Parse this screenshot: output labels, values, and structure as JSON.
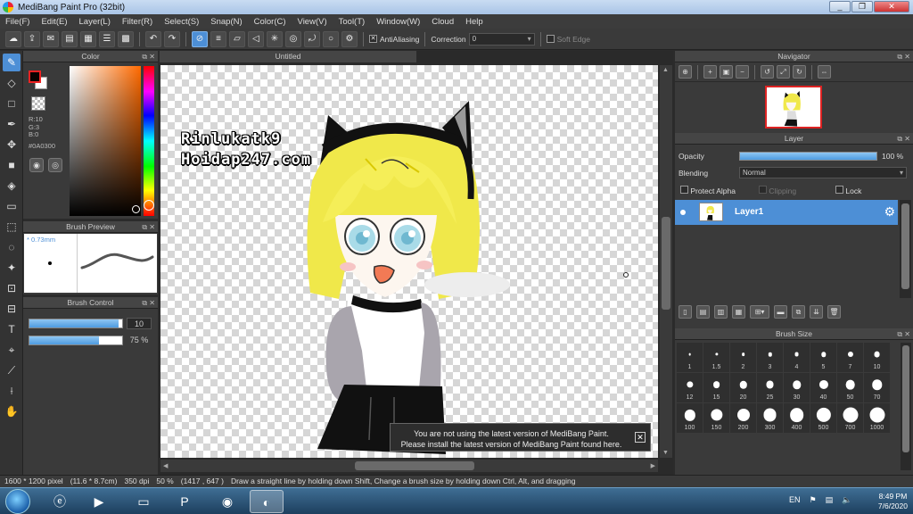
{
  "window": {
    "title": "MediBang Paint Pro (32bit)",
    "min": "_",
    "max": "❐",
    "close": "✕"
  },
  "menu": [
    "File(F)",
    "Edit(E)",
    "Layer(L)",
    "Filter(R)",
    "Select(S)",
    "Snap(N)",
    "Color(C)",
    "View(V)",
    "Tool(T)",
    "Window(W)",
    "Cloud",
    "Help"
  ],
  "toolbar": {
    "antialiasing_label": "AntiAliasing",
    "correction_label": "Correction",
    "correction_value": "0",
    "soft_edge_label": "Soft Edge"
  },
  "color_panel": {
    "title": "Color",
    "r": "R:10",
    "g": "G:3",
    "b": "B:0",
    "hex": "#0A0300",
    "fg_color": "#0a0300"
  },
  "brush_preview": {
    "title": "Brush Preview",
    "size_label": "* 0.73mm"
  },
  "brush_control": {
    "title": "Brush Control",
    "size_value": "10",
    "size_fill": 0.96,
    "opacity_value": "75 %",
    "opacity_fill": 0.75
  },
  "document": {
    "tab_title": "Untitled"
  },
  "watermark": {
    "line1": "Rinlukatk9",
    "line2": "Hoidap247.com"
  },
  "notice": {
    "line1": "You are not using the latest version of MediBang Paint.",
    "line2": "Please install the latest version of MediBang Paint found here.",
    "close": "✕"
  },
  "navigator": {
    "title": "Navigator"
  },
  "layer_panel": {
    "title": "Layer",
    "opacity_label": "Opacity",
    "opacity_value": "100 %",
    "blending_label": "Blending",
    "blending_value": "Normal",
    "protect_alpha": "Protect Alpha",
    "clipping": "Clipping",
    "lock": "Lock",
    "layers": [
      {
        "name": "Layer1"
      }
    ]
  },
  "brush_size": {
    "title": "Brush Size",
    "sizes": [
      "1",
      "1.5",
      "2",
      "3",
      "4",
      "5",
      "7",
      "10",
      "12",
      "15",
      "20",
      "25",
      "30",
      "40",
      "50",
      "70",
      "100",
      "150",
      "200",
      "300",
      "400",
      "500",
      "700",
      "1000"
    ]
  },
  "status": {
    "dimensions": "1600 * 1200 pixel",
    "physical": "(11.6 * 8.7cm)",
    "dpi": "350 dpi",
    "zoom": "50 %",
    "cursor": "(1417 , 647 )",
    "hint": "Draw a straight line by holding down Shift, Change a brush size by holding down Ctrl, Alt, and dragging"
  },
  "taskbar": {
    "lang": "EN",
    "time": "8:49 PM",
    "date": "7/6/2020"
  }
}
